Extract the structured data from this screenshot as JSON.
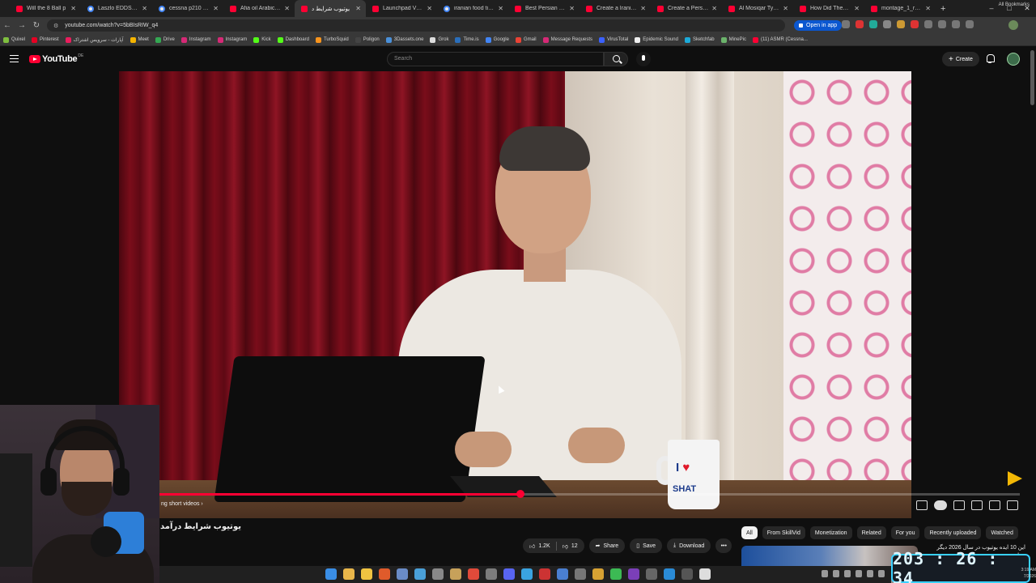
{
  "browser": {
    "tabs": [
      {
        "title": "Will the 8 Ball p",
        "icon": "youtube",
        "active": false
      },
      {
        "title": "Laszlo EDDS - Goo",
        "icon": "google",
        "active": false
      },
      {
        "title": "cessna p210 - Goo",
        "icon": "google",
        "active": false
      },
      {
        "title": "Afia oil Arabic men",
        "icon": "youtube",
        "active": false
      },
      {
        "title": "یوتیوب شرایط د",
        "icon": "youtube",
        "active": true
      },
      {
        "title": "Launchpad VS Laun",
        "icon": "youtube",
        "active": false
      },
      {
        "title": "iranian food tier lis",
        "icon": "google",
        "active": false
      },
      {
        "title": "Best Persian Food",
        "icon": "youtube",
        "active": false
      },
      {
        "title": "Create a Iranian fo",
        "icon": "youtube",
        "active": false
      },
      {
        "title": "Create a Persian Fo",
        "icon": "youtube",
        "active": false
      },
      {
        "title": "Al Mosiqar Type Be",
        "icon": "youtube",
        "active": false
      },
      {
        "title": "How Did They Mar",
        "icon": "youtube",
        "active": false
      },
      {
        "title": "montage_1_region",
        "icon": "youtube",
        "active": false
      }
    ],
    "new_tab": "+",
    "window_buttons": {
      "minimize": "–",
      "maximize": "□",
      "close": "✕"
    },
    "url": "youtube.com/watch?v=5bBIsRIW_q4",
    "open_in_app": "Open in app",
    "bookmarks": [
      {
        "label": "Quixel",
        "color": "#7fbf3f"
      },
      {
        "label": "Pinterest",
        "color": "#e60023"
      },
      {
        "label": "آپارات - سرویس اشتراک",
        "color": "#ea1d5d"
      },
      {
        "label": "Meet",
        "color": "#f4b400"
      },
      {
        "label": "Drive",
        "color": "#34a853"
      },
      {
        "label": "Instagram",
        "color": "#d62976"
      },
      {
        "label": "Instagram",
        "color": "#d62976"
      },
      {
        "label": "Kick",
        "color": "#53fc18"
      },
      {
        "label": "Dashboard",
        "color": "#53fc18"
      },
      {
        "label": "TurboSquid",
        "color": "#f7941d"
      },
      {
        "label": "Poligon",
        "color": "#444444"
      },
      {
        "label": "3Dassets.one",
        "color": "#4a90d9"
      },
      {
        "label": "Grok",
        "color": "#dddddd"
      },
      {
        "label": "Time.is",
        "color": "#2a6ebb"
      },
      {
        "label": "Google",
        "color": "#4285f4"
      },
      {
        "label": "Gmail",
        "color": "#ea4335"
      },
      {
        "label": "Message Requests",
        "color": "#d62976"
      },
      {
        "label": "VirusTotal",
        "color": "#3b61ff"
      },
      {
        "label": "Epidemic Sound",
        "color": "#eeeeee"
      },
      {
        "label": "Sketchfab",
        "color": "#1caad9"
      },
      {
        "label": "MinePic",
        "color": "#6bb36b"
      },
      {
        "label": "(11) ASMR (Cessna...",
        "color": "#ff0033"
      }
    ],
    "all_bookmarks": "All Bookmarks"
  },
  "youtube": {
    "logo_text": "YouTube",
    "country_code": "DE",
    "search_placeholder": "Search",
    "create_label": "Create",
    "video": {
      "title": "یوتیوب شرایط درآمد",
      "progress": 0.42,
      "shorts_label": "ng short videos  ›",
      "mug_line1": "I",
      "mug_heart": "♥",
      "mug_line2": "SHAT"
    },
    "actions": {
      "likes": "1.2K",
      "dislikes": "12",
      "share": "Share",
      "save": "Save",
      "download": "Download",
      "more": "•••"
    },
    "chips": [
      "All",
      "From SkillVid",
      "Monetization",
      "Related",
      "For you",
      "Recently uploaded",
      "Watched"
    ],
    "recommended_title": "این 10 ایده یوتیوب در سال 2026 دیگر جواب"
  },
  "overlay_counter": "203 : 26 : 34",
  "system_clock": {
    "time": "3:19 AM",
    "date": "7/2026"
  },
  "colors": {
    "accent_red": "#ff0033",
    "counter_border": "#39d1ff"
  }
}
